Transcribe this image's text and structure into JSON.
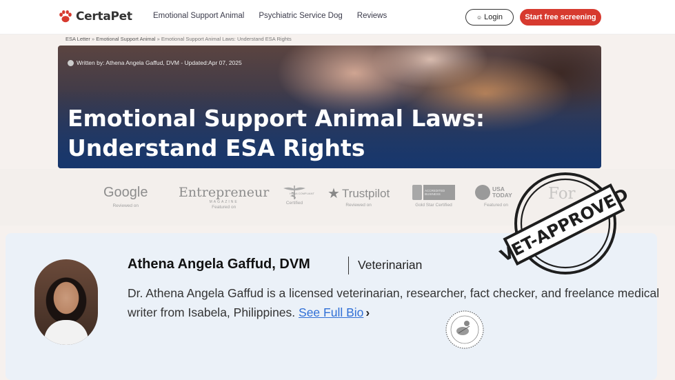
{
  "header": {
    "logo_text": "CertaPet",
    "nav": [
      "Emotional Support Animal",
      "Psychiatric Service Dog",
      "Reviews"
    ],
    "login_label": "Login",
    "cta_label": "Start free screening",
    "brand_color": "#d73a2f"
  },
  "breadcrumb": {
    "items": [
      "ESA Letter",
      "Emotional Support Animal",
      "Emotional Support Animal Laws: Understand ESA Rights"
    ],
    "separator": "»"
  },
  "hero": {
    "author_line": "Written by: Athena Angela Gaffud, DVM - Updated:Apr 07, 2025",
    "title": "Emotional Support Animal Laws: Understand ESA Rights"
  },
  "press": [
    {
      "brand": "Google",
      "sub": "Reviewed on"
    },
    {
      "brand": "Entrepreneur",
      "mag": "MAGAZINE",
      "sub": "Featured on"
    },
    {
      "brand": "HIPAA COMPLIANT",
      "sub": "Certified"
    },
    {
      "brand": "Trustpilot",
      "sub": "Reviewed on"
    },
    {
      "brand": "ACCREDITED BUSINESS",
      "sub": "Gold Star Certified"
    },
    {
      "brand": "USA TODAY",
      "sub": "Featured on"
    },
    {
      "brand": "For",
      "sub": ""
    }
  ],
  "author_card": {
    "name": "Athena Angela Gaffud, DVM",
    "role": "Veterinarian",
    "bio": "Dr. Athena Angela Gaffud is a licensed veterinarian, researcher, fact checker, and freelance medical writer from Isabela, Philippines.",
    "bio_link": "See Full Bio",
    "chevron": "›",
    "stamp_text": "VET-APPROVED"
  }
}
